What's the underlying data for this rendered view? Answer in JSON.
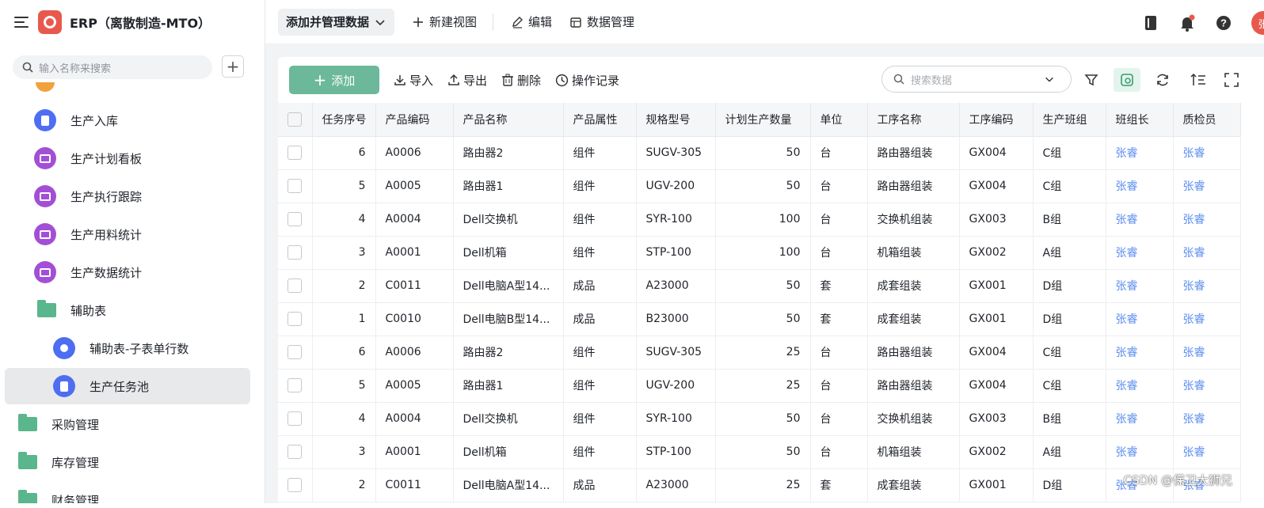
{
  "app": {
    "title": "ERP（离散制造-MTO）",
    "logo_icon": "app-logo-icon",
    "brand_color": "#e8594d"
  },
  "sidebar": {
    "search_placeholder": "输入名称来搜索",
    "add_label": "+",
    "items": [
      {
        "label": "生产入库",
        "icon": "form-icon"
      },
      {
        "label": "生产计划看板",
        "icon": "dashboard-icon"
      },
      {
        "label": "生产执行跟踪",
        "icon": "dashboard-icon"
      },
      {
        "label": "生产用料统计",
        "icon": "dashboard-icon"
      },
      {
        "label": "生产数据统计",
        "icon": "dashboard-icon"
      },
      {
        "label": "辅助表",
        "icon": "folder-icon"
      },
      {
        "label": "辅助表-子表单行数",
        "icon": "tag-icon"
      },
      {
        "label": "生产任务池",
        "icon": "form-icon",
        "active": true
      },
      {
        "label": "采购管理",
        "icon": "folder-icon"
      },
      {
        "label": "库存管理",
        "icon": "folder-icon"
      },
      {
        "label": "财务管理",
        "icon": "folder-icon"
      }
    ]
  },
  "topbar": {
    "primary": "添加并管理数据",
    "new_view": "新建视图",
    "edit": "编辑",
    "data_manage": "数据管理",
    "avatar_text": "张"
  },
  "toolbar": {
    "add": "添加",
    "import": "导入",
    "export": "导出",
    "delete": "删除",
    "history": "操作记录",
    "search_placeholder": "搜索数据",
    "accent": "#6cb89a"
  },
  "table": {
    "columns": [
      "任务序号",
      "产品编码",
      "产品名称",
      "产品属性",
      "规格型号",
      "计划生产数量",
      "单位",
      "工序名称",
      "工序编码",
      "生产班组",
      "班组长",
      "质检员"
    ],
    "rows": [
      [
        "6",
        "A0006",
        "路由器2",
        "组件",
        "SUGV-305",
        "50",
        "台",
        "路由器组装",
        "GX004",
        "C组",
        "张睿",
        "张睿"
      ],
      [
        "5",
        "A0005",
        "路由器1",
        "组件",
        "UGV-200",
        "50",
        "台",
        "路由器组装",
        "GX004",
        "C组",
        "张睿",
        "张睿"
      ],
      [
        "4",
        "A0004",
        "Dell交换机",
        "组件",
        "SYR-100",
        "100",
        "台",
        "交换机组装",
        "GX003",
        "B组",
        "张睿",
        "张睿"
      ],
      [
        "3",
        "A0001",
        "Dell机箱",
        "组件",
        "STP-100",
        "100",
        "台",
        "机箱组装",
        "GX002",
        "A组",
        "张睿",
        "张睿"
      ],
      [
        "2",
        "C0011",
        "Dell电脑A型14...",
        "成品",
        "A23000",
        "50",
        "套",
        "成套组装",
        "GX001",
        "D组",
        "张睿",
        "张睿"
      ],
      [
        "1",
        "C0010",
        "Dell电脑B型14...",
        "成品",
        "B23000",
        "50",
        "套",
        "成套组装",
        "GX001",
        "D组",
        "张睿",
        "张睿"
      ],
      [
        "6",
        "A0006",
        "路由器2",
        "组件",
        "SUGV-305",
        "25",
        "台",
        "路由器组装",
        "GX004",
        "C组",
        "张睿",
        "张睿"
      ],
      [
        "5",
        "A0005",
        "路由器1",
        "组件",
        "UGV-200",
        "25",
        "台",
        "路由器组装",
        "GX004",
        "C组",
        "张睿",
        "张睿"
      ],
      [
        "4",
        "A0004",
        "Dell交换机",
        "组件",
        "SYR-100",
        "50",
        "台",
        "交换机组装",
        "GX003",
        "B组",
        "张睿",
        "张睿"
      ],
      [
        "3",
        "A0001",
        "Dell机箱",
        "组件",
        "STP-100",
        "50",
        "台",
        "机箱组装",
        "GX002",
        "A组",
        "张睿",
        "张睿"
      ],
      [
        "2",
        "C0011",
        "Dell电脑A型14...",
        "成品",
        "A23000",
        "25",
        "套",
        "成套组装",
        "GX001",
        "D组",
        "张睿",
        "张睿"
      ]
    ]
  },
  "watermark": "CSDN @保卫大狮兄"
}
